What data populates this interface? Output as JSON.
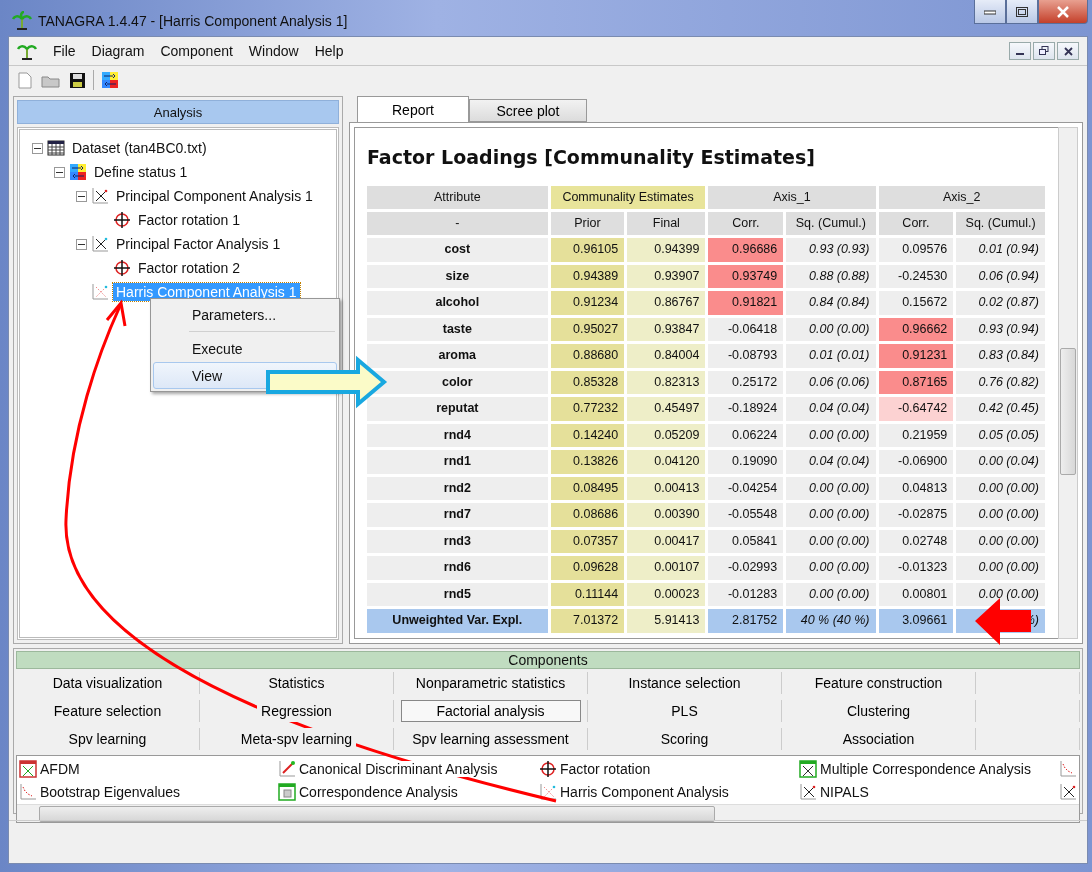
{
  "window": {
    "title": "TANAGRA 1.4.47 - [Harris Component Analysis 1]"
  },
  "menu": [
    "File",
    "Diagram",
    "Component",
    "Window",
    "Help"
  ],
  "analysis": {
    "title": "Analysis",
    "tree": [
      {
        "label": "Dataset (tan4BC0.txt)",
        "kind": "dataset",
        "expanded": true,
        "selected": false,
        "children": [
          {
            "label": "Define status 1",
            "kind": "status",
            "expanded": true,
            "selected": false,
            "children": [
              {
                "label": "Principal Component Analysis 1",
                "kind": "pca",
                "expanded": true,
                "selected": false,
                "children": [
                  {
                    "label": "Factor rotation 1",
                    "kind": "rotation",
                    "selected": false
                  }
                ]
              },
              {
                "label": "Principal Factor Analysis 1",
                "kind": "pfa",
                "expanded": true,
                "selected": false,
                "children": [
                  {
                    "label": "Factor rotation 2",
                    "kind": "rotation",
                    "selected": false
                  }
                ]
              },
              {
                "label": "Harris Component Analysis 1",
                "kind": "harris",
                "selected": true
              }
            ]
          }
        ]
      }
    ]
  },
  "context_menu": [
    {
      "label": "Parameters...",
      "selected": false
    },
    {
      "label": "Execute",
      "selected": false
    },
    {
      "label": "View",
      "selected": true
    }
  ],
  "tabs": [
    {
      "label": "Report",
      "selected": true
    },
    {
      "label": "Scree plot",
      "selected": false
    }
  ],
  "report": {
    "title": "Factor Loadings [Communality Estimates]",
    "groups": [
      {
        "label": "Attribute",
        "color": "#dedede"
      },
      {
        "label": "Communality Estimates",
        "color": "#e8e49a"
      },
      {
        "label": "Axis_1",
        "color": "#dedede"
      },
      {
        "label": "Axis_2",
        "color": "#dedede"
      }
    ],
    "columns": [
      {
        "label": "-",
        "kind": "attribute"
      },
      {
        "label": "Prior",
        "kind": "prior"
      },
      {
        "label": "Final",
        "kind": "final"
      },
      {
        "label": "Corr.",
        "kind": "corr"
      },
      {
        "label": "Sq. (Cumul.)",
        "kind": "sq"
      },
      {
        "label": "Corr.",
        "kind": "corr"
      },
      {
        "label": "Sq. (Cumul.)",
        "kind": "sq"
      }
    ],
    "rows": [
      {
        "kind": "data",
        "attribute": "cost",
        "values": [
          {
            "text": "0.96105"
          },
          {
            "text": "0.94399"
          },
          {
            "text": "0.96686",
            "color": "#fa8c8c"
          },
          {
            "text": "0.93 (0.93)"
          },
          {
            "text": "0.09576"
          },
          {
            "text": "0.01 (0.94)"
          }
        ]
      },
      {
        "kind": "data",
        "attribute": "size",
        "values": [
          {
            "text": "0.94389"
          },
          {
            "text": "0.93907"
          },
          {
            "text": "0.93749",
            "color": "#fa8c8c"
          },
          {
            "text": "0.88 (0.88)"
          },
          {
            "text": "-0.24530"
          },
          {
            "text": "0.06 (0.94)"
          }
        ]
      },
      {
        "kind": "data",
        "attribute": "alcohol",
        "values": [
          {
            "text": "0.91234"
          },
          {
            "text": "0.86767"
          },
          {
            "text": "0.91821",
            "color": "#fa8c8c"
          },
          {
            "text": "0.84 (0.84)"
          },
          {
            "text": "0.15672"
          },
          {
            "text": "0.02 (0.87)"
          }
        ]
      },
      {
        "kind": "data",
        "attribute": "taste",
        "values": [
          {
            "text": "0.95027"
          },
          {
            "text": "0.93847"
          },
          {
            "text": "-0.06418"
          },
          {
            "text": "0.00 (0.00)"
          },
          {
            "text": "0.96662",
            "color": "#fa8c8c"
          },
          {
            "text": "0.93 (0.94)"
          }
        ]
      },
      {
        "kind": "data",
        "attribute": "aroma",
        "values": [
          {
            "text": "0.88680"
          },
          {
            "text": "0.84004"
          },
          {
            "text": "-0.08793"
          },
          {
            "text": "0.01 (0.01)"
          },
          {
            "text": "0.91231",
            "color": "#fa8c8c"
          },
          {
            "text": "0.83 (0.84)"
          }
        ]
      },
      {
        "kind": "data",
        "attribute": "color",
        "values": [
          {
            "text": "0.85328"
          },
          {
            "text": "0.82313"
          },
          {
            "text": "0.25172"
          },
          {
            "text": "0.06 (0.06)"
          },
          {
            "text": "0.87165",
            "color": "#fa8c8c"
          },
          {
            "text": "0.76 (0.82)"
          }
        ]
      },
      {
        "kind": "data",
        "attribute": "reputat",
        "values": [
          {
            "text": "0.77232"
          },
          {
            "text": "0.45497"
          },
          {
            "text": "-0.18924"
          },
          {
            "text": "0.04 (0.04)"
          },
          {
            "text": "-0.64742",
            "color": "#fcd2d2"
          },
          {
            "text": "0.42 (0.45)"
          }
        ]
      },
      {
        "kind": "plain",
        "attribute": "rnd4",
        "values": [
          {
            "text": "0.14240"
          },
          {
            "text": "0.05209"
          },
          {
            "text": "0.06224"
          },
          {
            "text": "0.00 (0.00)"
          },
          {
            "text": "0.21959"
          },
          {
            "text": "0.05 (0.05)"
          }
        ]
      },
      {
        "kind": "plain",
        "attribute": "rnd1",
        "values": [
          {
            "text": "0.13826"
          },
          {
            "text": "0.04120"
          },
          {
            "text": "0.19090"
          },
          {
            "text": "0.04 (0.04)"
          },
          {
            "text": "-0.06900"
          },
          {
            "text": "0.00 (0.04)"
          }
        ]
      },
      {
        "kind": "plain",
        "attribute": "rnd2",
        "values": [
          {
            "text": "0.08495"
          },
          {
            "text": "0.00413"
          },
          {
            "text": "-0.04254"
          },
          {
            "text": "0.00 (0.00)"
          },
          {
            "text": "0.04813"
          },
          {
            "text": "0.00 (0.00)"
          }
        ]
      },
      {
        "kind": "plain",
        "attribute": "rnd7",
        "values": [
          {
            "text": "0.08686"
          },
          {
            "text": "0.00390"
          },
          {
            "text": "-0.05548"
          },
          {
            "text": "0.00 (0.00)"
          },
          {
            "text": "-0.02875"
          },
          {
            "text": "0.00 (0.00)"
          }
        ]
      },
      {
        "kind": "plain",
        "attribute": "rnd3",
        "values": [
          {
            "text": "0.07357"
          },
          {
            "text": "0.00417"
          },
          {
            "text": "0.05841"
          },
          {
            "text": "0.00 (0.00)"
          },
          {
            "text": "0.02748"
          },
          {
            "text": "0.00 (0.00)"
          }
        ]
      },
      {
        "kind": "plain",
        "attribute": "rnd6",
        "values": [
          {
            "text": "0.09628"
          },
          {
            "text": "0.00107"
          },
          {
            "text": "-0.02993"
          },
          {
            "text": "0.00 (0.00)"
          },
          {
            "text": "-0.01323"
          },
          {
            "text": "0.00 (0.00)"
          }
        ]
      },
      {
        "kind": "plain",
        "attribute": "rnd5",
        "values": [
          {
            "text": "0.11144"
          },
          {
            "text": "0.00023"
          },
          {
            "text": "-0.01283"
          },
          {
            "text": "0.00 (0.00)"
          },
          {
            "text": "0.00801"
          },
          {
            "text": "0.00 (0.00)"
          }
        ]
      },
      {
        "kind": "total",
        "attribute": "Unweighted Var. Expl.",
        "values": [
          {
            "text": "7.01372"
          },
          {
            "text": "5.91413"
          },
          {
            "text": "2.81752"
          },
          {
            "text": "40 % (40 %)"
          },
          {
            "text": "3.09661"
          },
          {
            "text": "%)"
          }
        ]
      }
    ]
  },
  "components": {
    "title": "Components",
    "categories": [
      {
        "label": "Data visualization",
        "selected": false
      },
      {
        "label": "Statistics",
        "selected": false
      },
      {
        "label": "Nonparametric statistics",
        "selected": false
      },
      {
        "label": "Instance selection",
        "selected": false
      },
      {
        "label": "Feature construction",
        "selected": false
      },
      {
        "label": "Feature selection",
        "selected": false
      },
      {
        "label": "Regression",
        "selected": false
      },
      {
        "label": "Factorial analysis",
        "selected": true
      },
      {
        "label": "PLS",
        "selected": false
      },
      {
        "label": "Clustering",
        "selected": false
      },
      {
        "label": "Spv learning",
        "selected": false
      },
      {
        "label": "Meta-spv learning",
        "selected": false
      },
      {
        "label": "Spv learning assessment",
        "selected": false
      },
      {
        "label": "Scoring",
        "selected": false
      },
      {
        "label": "Association",
        "selected": false
      }
    ],
    "items": [
      {
        "label": "AFDM",
        "kind": "afdm"
      },
      {
        "label": "Canonical Discriminant Analysis",
        "kind": "canonical"
      },
      {
        "label": "Factor rotation",
        "kind": "rotation"
      },
      {
        "label": "Multiple Correspondence Analysis",
        "kind": "mca"
      },
      {
        "label": "Bootstrap Eigenvalues",
        "kind": "bootstrap"
      },
      {
        "label": "Correspondence Analysis",
        "kind": "correspondence"
      },
      {
        "label": "Harris Component Analysis",
        "kind": "harris"
      },
      {
        "label": "NIPALS",
        "kind": "nipals"
      }
    ]
  }
}
